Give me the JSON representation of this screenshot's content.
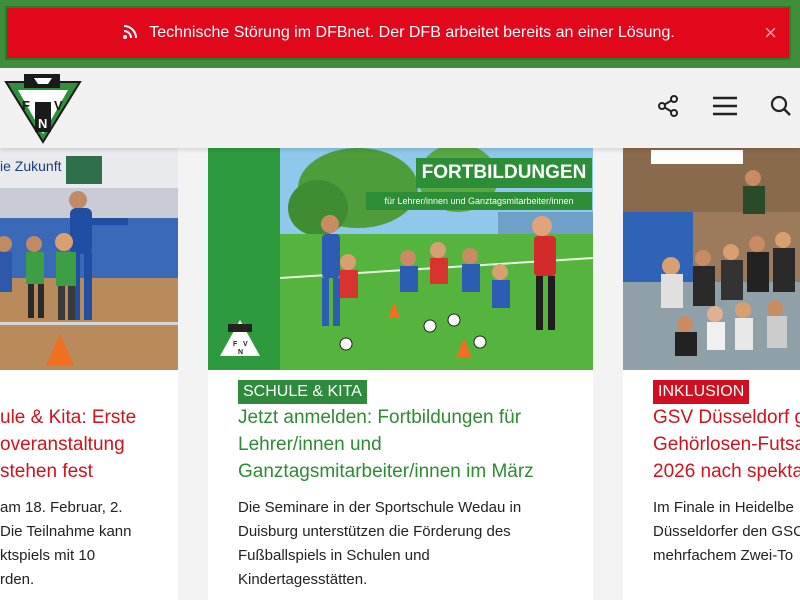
{
  "alert": {
    "message": "Technische Störung im DFBnet. Der DFB arbeitet bereits an einer Lösung.",
    "close_label": "×",
    "icon": "rss-icon"
  },
  "header": {
    "logo_letters": [
      "F",
      "V",
      "N"
    ],
    "icons": [
      "share-icon",
      "menu-icon",
      "search-icon"
    ]
  },
  "cards": [
    {
      "image_caption": "ie Zukunft",
      "badge": "",
      "title_lines": [
        "ule & Kita: Erste",
        "overanstaltung",
        "stehen fest"
      ],
      "desc_lines": [
        "am 18. Februar, 2.",
        "Die Teilnahme kann",
        "ktspiels mit 10",
        "rden."
      ]
    },
    {
      "image_title": "FORTBILDUNGEN",
      "image_subtitle": "für Lehrer/innen und Ganztagsmitarbeiter/innen",
      "badge": "SCHULE & KITA",
      "title_lines": [
        "Jetzt anmelden: Fortbildungen für",
        "Lehrer/innen und",
        "Ganztagsmitarbeiter/innen im März"
      ],
      "desc_lines": [
        "Die Seminare in der Sportschule Wedau in",
        "Duisburg unterstützen die Förderung des",
        "Fußballspiels in Schulen und",
        "Kindertagesstätten."
      ]
    },
    {
      "badge": "INKLUSION",
      "title_lines": [
        "GSV Düsseldorf g",
        "Gehörlosen-Futsa",
        "2026 nach spekta"
      ],
      "desc_lines": [
        "Im Finale in Heidelbe",
        "Düsseldorfer den GSC",
        "mehrfachem Zwei-To"
      ]
    }
  ],
  "colors": {
    "alert_red": "#e2081c",
    "brand_green": "#2e8b3b",
    "title_red": "#d0121b",
    "badge_red": "#cf1020",
    "title_green": "#2f8a35"
  }
}
